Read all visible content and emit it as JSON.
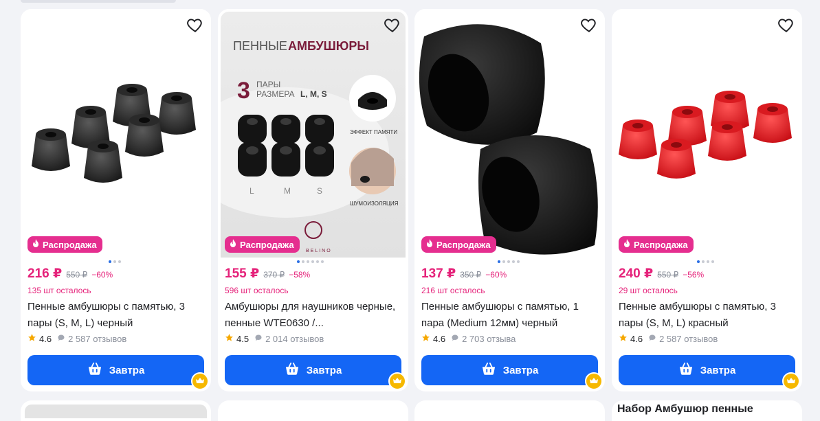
{
  "badge_label": "Распродажа",
  "cart_button_label": "Завтра",
  "products": [
    {
      "price": "216 ₽",
      "old_price": "550 ₽",
      "discount": "−60%",
      "stock": "135 шт осталось",
      "title": "Пенные амбушюры с памятью, 3 пары (S, M, L) черный",
      "rating": "4.6",
      "reviews": "2 587 отзывов"
    },
    {
      "price": "155 ₽",
      "old_price": "370 ₽",
      "discount": "−58%",
      "stock": "596 шт осталось",
      "title": "Амбушюры для наушников черные, пенные WTE0630 /...",
      "rating": "4.5",
      "reviews": "2 014 отзывов"
    },
    {
      "price": "137 ₽",
      "old_price": "350 ₽",
      "discount": "−60%",
      "stock": "216 шт осталось",
      "title": "Пенные амбушюры с памятью, 1 пара (Medium 12мм) черный",
      "rating": "4.6",
      "reviews": "2 703 отзыва"
    },
    {
      "price": "240 ₽",
      "old_price": "550 ₽",
      "discount": "−56%",
      "stock": "29 шт осталось",
      "title": "Пенные амбушюры с памятью, 3 пары (S, M, L) красный",
      "rating": "4.6",
      "reviews": "2 587 отзывов"
    }
  ],
  "promo_image": {
    "heading_light": "ПЕННЫЕ",
    "heading_bold": "АМБУШЮРЫ",
    "count": "3",
    "pairs_label": "ПАРЫ",
    "sizes_label": "РАЗМЕРА",
    "sizes_bold": "L, M, S",
    "size_l": "L",
    "size_m": "M",
    "size_s": "S",
    "feature_memory": "ЭФФЕКТ ПАМЯТИ",
    "feature_noise": "ШУМОИЗОЛЯЦИЯ",
    "brand": "BELINO"
  },
  "next_row_title": "Набор Амбушюр пенные",
  "colors": {
    "accent": "#1466f5",
    "sale": "#e52e8f",
    "price": "#e5227a",
    "star": "#f6a800"
  }
}
